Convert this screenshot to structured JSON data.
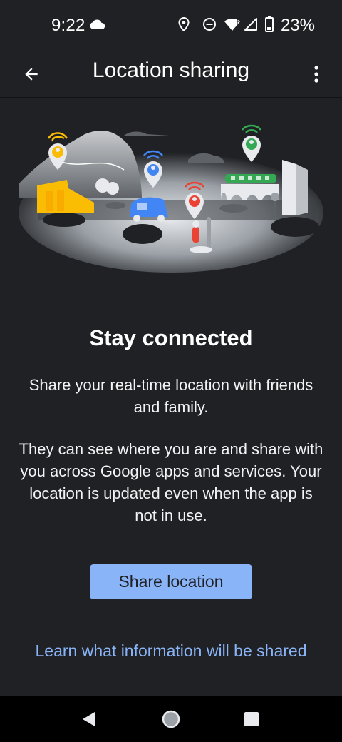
{
  "status_bar": {
    "time": "9:22",
    "battery_percent": "23%",
    "icons": [
      "cloud-icon",
      "location-icon",
      "dnd-icon",
      "wifi-icon",
      "signal-icon",
      "battery-icon"
    ]
  },
  "app_bar": {
    "title": "Location sharing",
    "back_icon": "arrow-back-icon",
    "menu_icon": "more-vert-icon"
  },
  "main": {
    "headline": "Stay connected",
    "body_1": "Share your real-time location with friends and family.",
    "body_2": "They can see where you are and share with you across Google apps and services. Your location is updated even when the app is not in use.",
    "share_button_label": "Share location",
    "learn_link": "Learn what information will be shared"
  },
  "nav_bar": {
    "back_icon": "nav-back-icon",
    "home_icon": "nav-home-icon",
    "recents_icon": "nav-recents-icon"
  },
  "colors": {
    "background": "#202124",
    "accent": "#8ab4f8",
    "pin_yellow": "#fbbc04",
    "pin_blue": "#4285f4",
    "pin_red": "#ea4335",
    "pin_green": "#34a853"
  }
}
